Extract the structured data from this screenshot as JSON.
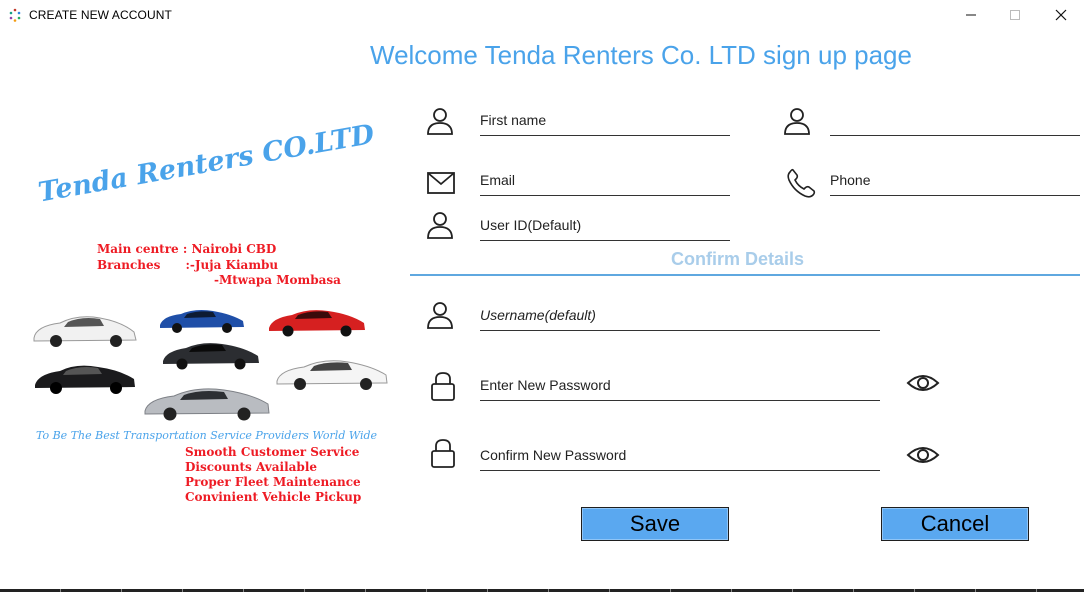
{
  "window": {
    "title": "CREATE NEW ACCOUNT"
  },
  "heading": "Welcome Tenda Renters Co. LTD sign up page",
  "poster": {
    "brand": "Tenda Renters CO.LTD",
    "main_centre": "Main centre : Nairobi CBD",
    "branches": "Branches      :-Juja Kiambu",
    "branches2": "-Mtwapa Mombasa",
    "tagline": "To Be The Best Transportation Service Providers World Wide",
    "features": [
      "Smooth Customer Service",
      "Discounts Available",
      "Proper Fleet Maintenance",
      "Convinient Vehicle Pickup"
    ]
  },
  "form": {
    "first_name": "First name",
    "last_name": "",
    "email": "Email",
    "phone": "Phone",
    "user_id": "User ID(Default)",
    "confirm_details": "Confirm Details",
    "username": "Username(default)",
    "new_password": "Enter New Password",
    "confirm_password": "Confirm New Password"
  },
  "buttons": {
    "save": "Save",
    "cancel": "Cancel"
  },
  "colors": {
    "accent": "#4aa3ea",
    "button": "#5aa8f0",
    "poster_red": "#ee1b24"
  }
}
